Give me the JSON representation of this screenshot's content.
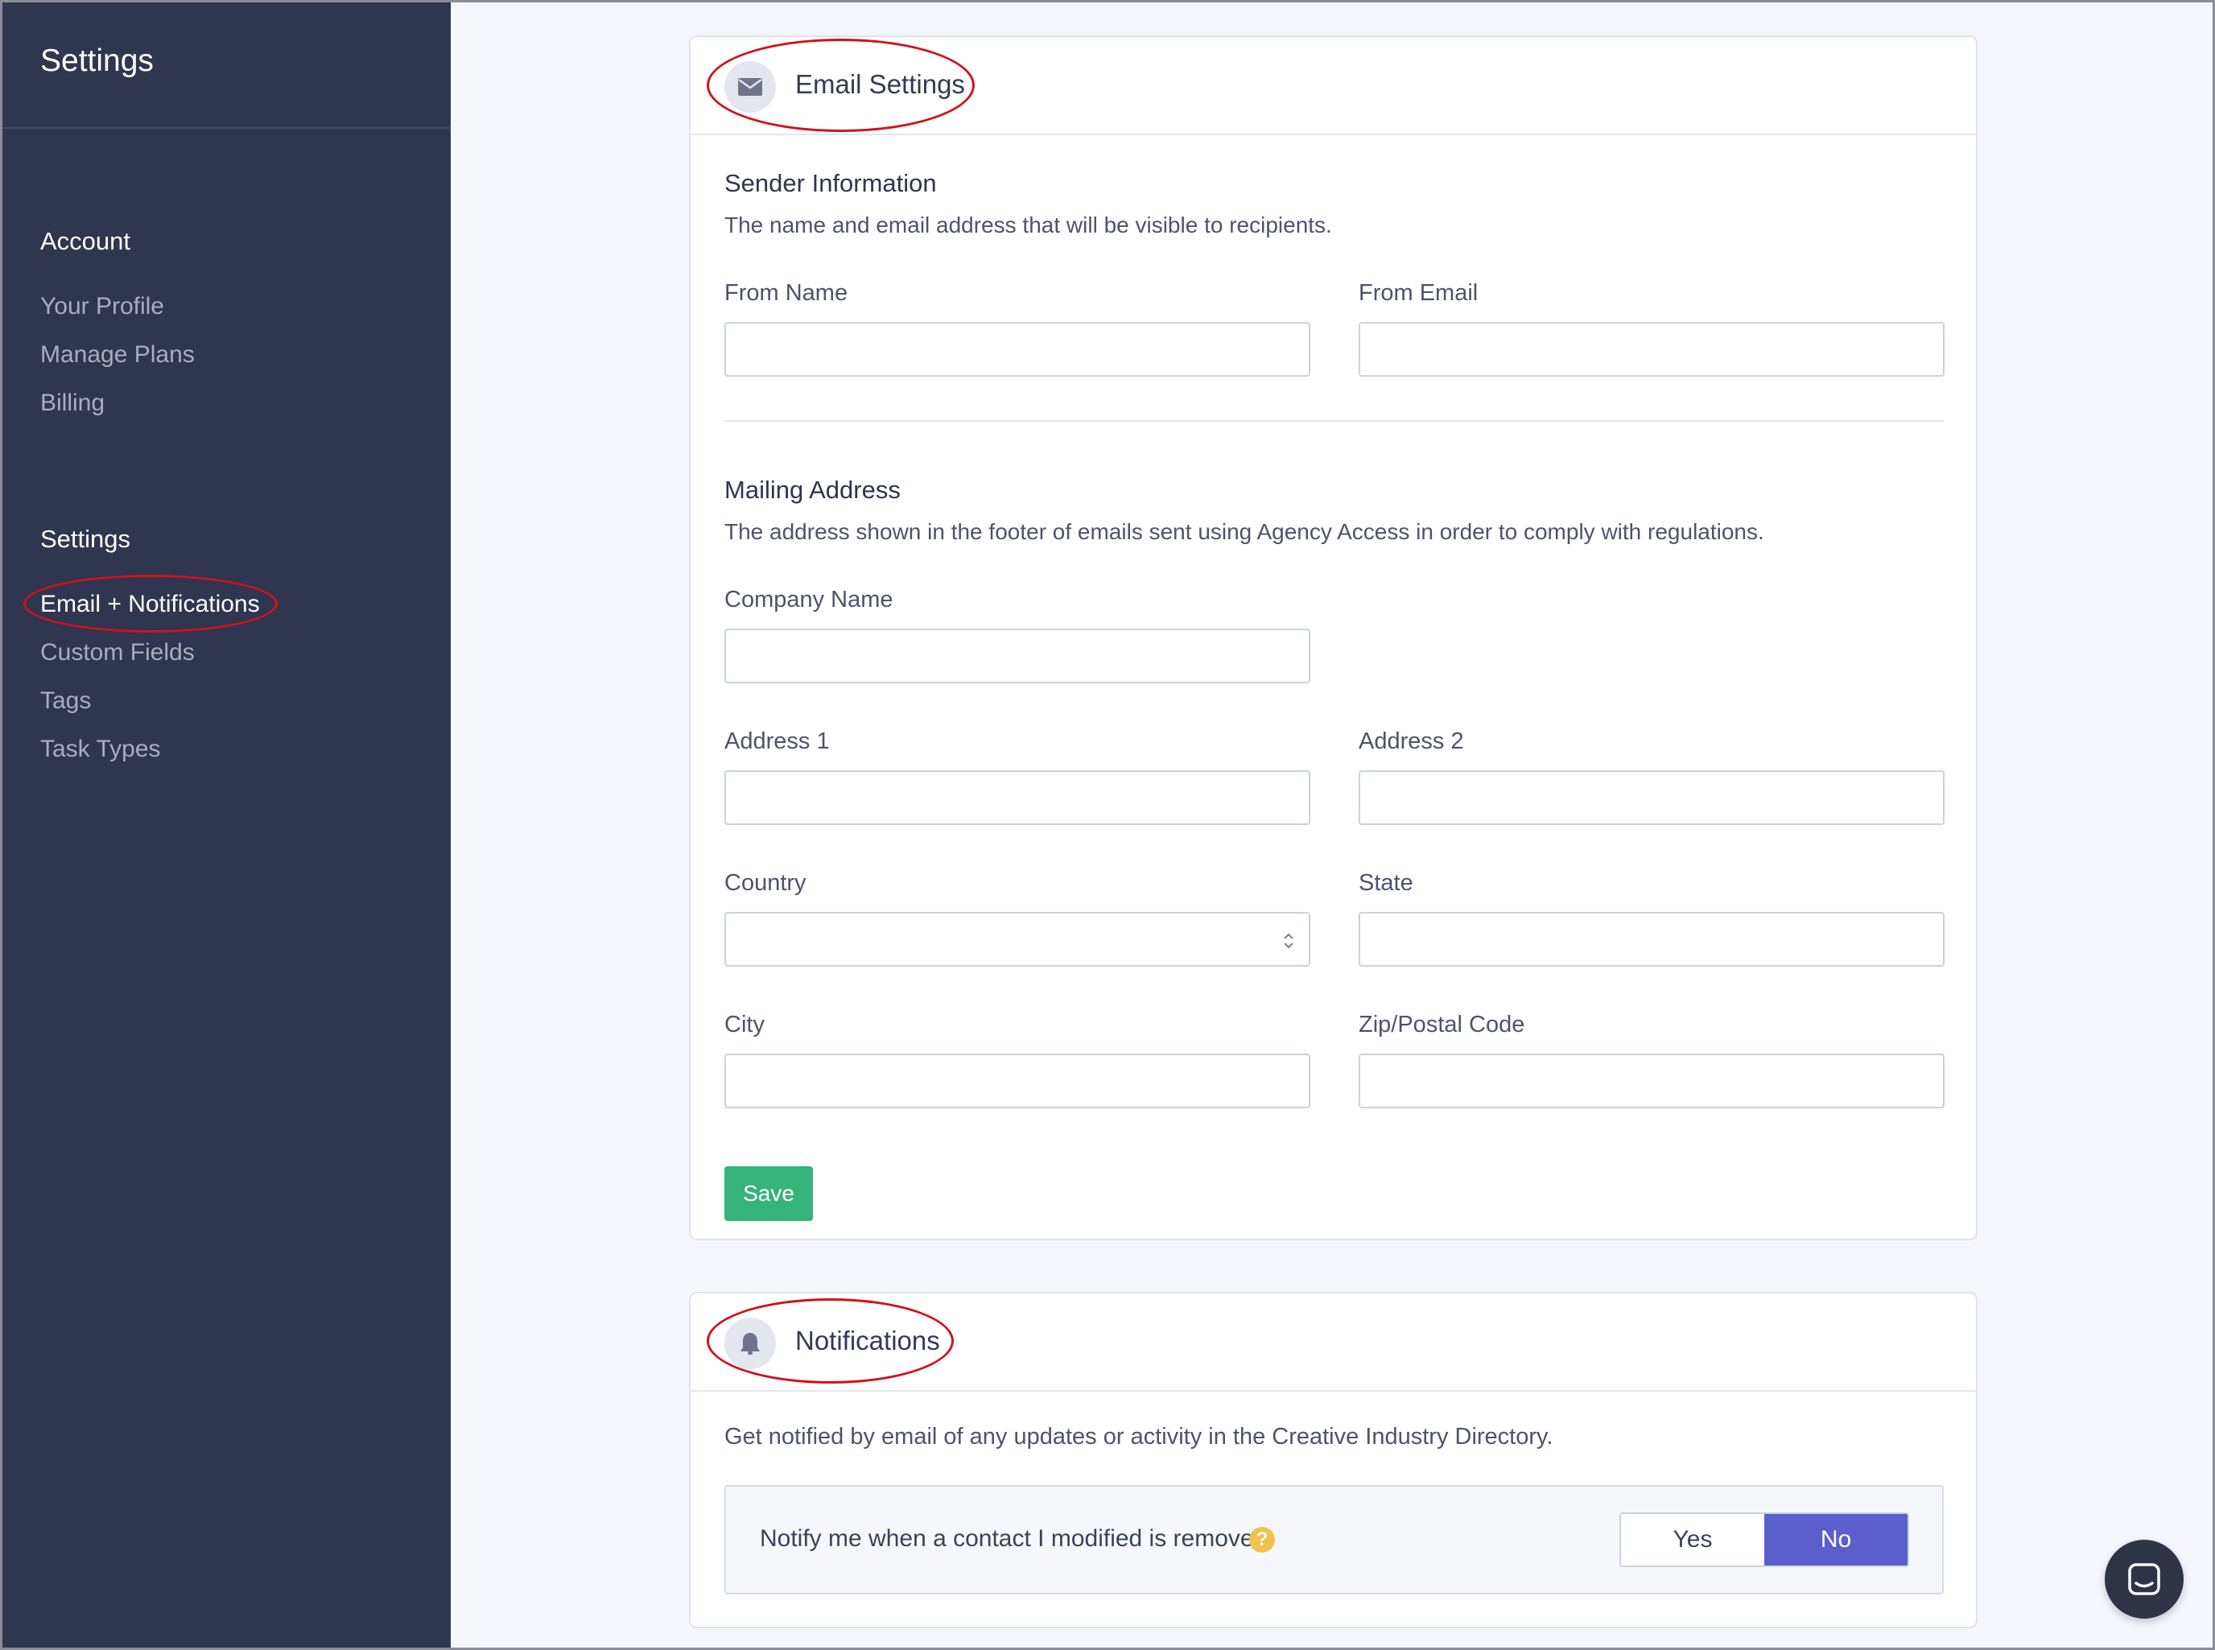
{
  "sidebar": {
    "title": "Settings",
    "sections": [
      {
        "heading": "Account",
        "items": [
          {
            "label": "Your Profile"
          },
          {
            "label": "Manage Plans"
          },
          {
            "label": "Billing"
          }
        ]
      },
      {
        "heading": "Settings",
        "items": [
          {
            "label": "Email + Notifications",
            "active": true
          },
          {
            "label": "Custom Fields"
          },
          {
            "label": "Tags"
          },
          {
            "label": "Task Types"
          }
        ]
      }
    ]
  },
  "email_settings": {
    "title": "Email Settings",
    "icon": "envelope-icon",
    "sender": {
      "title": "Sender Information",
      "description": "The name and email address that will be visible to recipients.",
      "from_name_label": "From Name",
      "from_name_value": "",
      "from_email_label": "From Email",
      "from_email_value": ""
    },
    "mailing": {
      "title": "Mailing Address",
      "description": "The address shown in the footer of emails sent using Agency Access in order to comply with regulations.",
      "company_label": "Company Name",
      "company_value": "",
      "address1_label": "Address 1",
      "address1_value": "",
      "address2_label": "Address 2",
      "address2_value": "",
      "country_label": "Country",
      "country_value": "",
      "state_label": "State",
      "state_value": "",
      "city_label": "City",
      "city_value": "",
      "zip_label": "Zip/Postal Code",
      "zip_value": ""
    },
    "save_label": "Save"
  },
  "notifications": {
    "title": "Notifications",
    "icon": "bell-icon",
    "description": "Get notified by email of any updates or activity in the Creative Industry Directory.",
    "setting_label": "Notify me when a contact I modified is removed",
    "help_glyph": "?",
    "options": {
      "yes": "Yes",
      "no": "No"
    },
    "selected": "No"
  },
  "colors": {
    "sidebar_bg": "#303550",
    "save_button": "#35b37a",
    "toggle_selected": "#5a5fcc",
    "annotation": "#d0121b"
  }
}
